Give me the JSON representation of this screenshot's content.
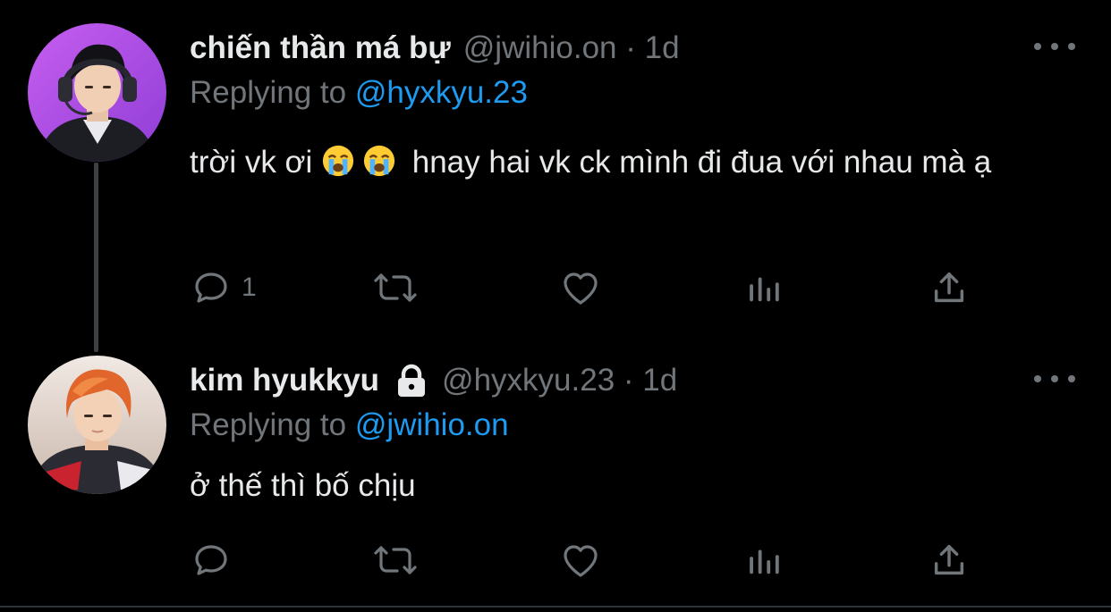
{
  "theme": {
    "background": "#000000",
    "text_primary": "#e7e9ea",
    "text_secondary": "#71767b",
    "accent": "#1d9bf0"
  },
  "tweets": [
    {
      "display_name": "chiến thần má bự",
      "handle": "@jwihio.on",
      "time": "1d",
      "locked": false,
      "replying_prefix": "Replying to",
      "replying_to": "@hyxkyu.23",
      "text_before_emoji": "trời vk ơi",
      "emoji": [
        "loudly-crying-face",
        "loudly-crying-face"
      ],
      "text_after_emoji": " hnay hai vk ck mình đi đua với nhau mà ạ",
      "reply_count": "1",
      "icons": [
        "reply-icon",
        "retweet-icon",
        "like-icon",
        "views-icon",
        "share-icon"
      ]
    },
    {
      "display_name": "kim hyukkyu",
      "handle": "@hyxkyu.23",
      "time": "1d",
      "locked": true,
      "replying_prefix": "Replying to",
      "replying_to": "@jwihio.on",
      "text": "ở thế thì bố chịu",
      "reply_count": "",
      "icons": [
        "reply-icon",
        "retweet-icon",
        "like-icon",
        "views-icon",
        "share-icon"
      ]
    }
  ],
  "meta_separator": "·"
}
